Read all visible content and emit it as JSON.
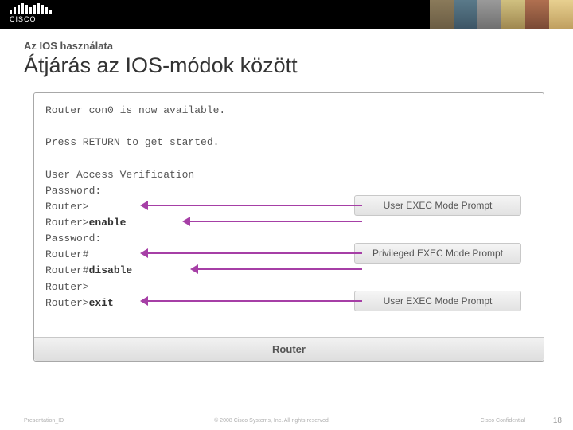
{
  "logo_text": "CISCO",
  "section_label": "Az IOS használata",
  "title": "Átjárás az IOS-módok között",
  "terminal": {
    "line1": "Router con0 is now available.",
    "line2": "Press RETURN to get started.",
    "line3": "User Access Verification",
    "line4": "Password:",
    "line5": "Router>",
    "line6a": "Router>",
    "line6b": "enable",
    "line7": "Password:",
    "line8": "Router#",
    "line9a": "Router#",
    "line9b": "disable",
    "line10": "Router>",
    "line11a": "Router>",
    "line11b": "exit"
  },
  "callouts": {
    "c1": "User EXEC Mode Prompt",
    "c2": "Privileged EXEC Mode Prompt",
    "c3": "User EXEC Mode Prompt"
  },
  "router_label": "Router",
  "footer": {
    "pid": "Presentation_ID",
    "copy": "© 2008 Cisco Systems, Inc. All rights reserved.",
    "conf": "Cisco Confidential",
    "page": "18"
  }
}
